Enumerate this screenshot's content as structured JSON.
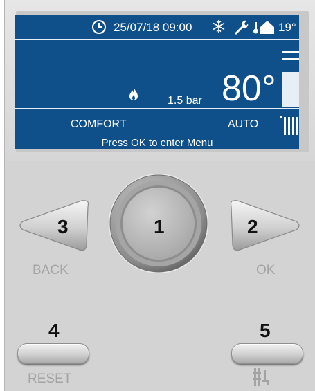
{
  "status_bar": {
    "datetime": "25/07/18 09:00",
    "outdoor_temp": "19°",
    "icons": [
      "clock-icon",
      "snowflake-icon",
      "wrench-icon",
      "outdoor-thermometer-house-icon"
    ]
  },
  "main": {
    "pressure": "1.5 bar",
    "flow_temp": "80°",
    "icons": [
      "flame-icon",
      "radiator-icon"
    ],
    "level_bar_fill": 0.62
  },
  "modes": {
    "left": "COMFORT",
    "right": "AUTO"
  },
  "hint": "Press OK to enter Menu",
  "buttons": {
    "center_number": "1",
    "ok_number": "2",
    "back_number": "3",
    "reset_number": "4",
    "hw_number": "5",
    "back_label": "BACK",
    "ok_label": "OK",
    "reset_label": "RESET"
  },
  "colors": {
    "screen_bg": "#10508a",
    "panel_bg": "#d3d3d3",
    "label_grey": "#a3a3a3"
  }
}
